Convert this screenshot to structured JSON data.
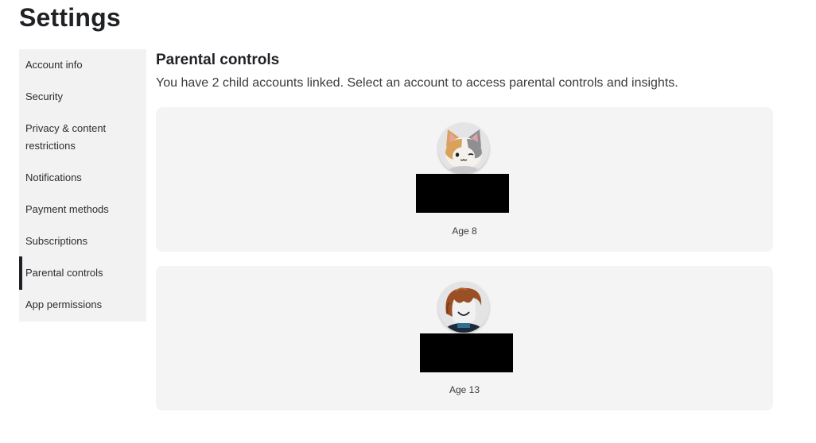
{
  "page": {
    "title": "Settings"
  },
  "sidebar": {
    "items": [
      {
        "label": "Account info"
      },
      {
        "label": "Security"
      },
      {
        "label": "Privacy & content",
        "label2": "restrictions"
      },
      {
        "label": "Notifications"
      },
      {
        "label": "Payment methods"
      },
      {
        "label": "Subscriptions"
      },
      {
        "label": "Parental controls",
        "active": true
      },
      {
        "label": "App permissions"
      }
    ]
  },
  "main": {
    "title": "Parental controls",
    "description": "You have 2 child accounts linked. Select an account to access parental controls and insights.",
    "accounts": [
      {
        "age": "Age 8",
        "avatar": "cat-avatar-icon"
      },
      {
        "age": "Age 13",
        "avatar": "bacon-hair-avatar-icon"
      }
    ]
  }
}
